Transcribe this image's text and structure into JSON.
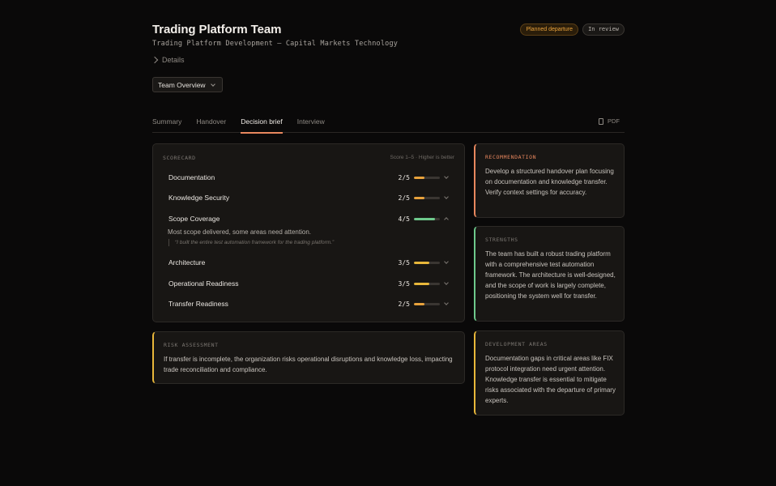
{
  "header": {
    "title": "Trading Platform Team",
    "subtitle": "Trading Platform Development — Capital Markets Technology",
    "details_label": "Details",
    "badges": {
      "planned": "Planned departure",
      "review": "In review"
    }
  },
  "team_select": {
    "selected": "Team Overview"
  },
  "tabs": [
    {
      "label": "Summary"
    },
    {
      "label": "Handover"
    },
    {
      "label": "Decision brief",
      "active": true
    },
    {
      "label": "Interview"
    }
  ],
  "pdf_label": "PDF",
  "scorecard": {
    "label": "SCORECARD",
    "hint": "Score 1–5 · Higher is better",
    "rows": [
      {
        "name": "Documentation",
        "score": "2/5",
        "value": 2,
        "color": "#e8a23c"
      },
      {
        "name": "Knowledge Security",
        "score": "2/5",
        "value": 2,
        "color": "#e8a23c"
      },
      {
        "name": "Scope Coverage",
        "score": "4/5",
        "value": 4,
        "color": "#6ec98c",
        "expanded": true
      },
      {
        "name": "Architecture",
        "score": "3/5",
        "value": 3,
        "color": "#e8b73a"
      },
      {
        "name": "Operational Readiness",
        "score": "3/5",
        "value": 3,
        "color": "#e8b73a"
      },
      {
        "name": "Transfer Readiness",
        "score": "2/5",
        "value": 2,
        "color": "#e8a23c"
      }
    ],
    "expanded_note": "Most scope delivered, some areas need attention.",
    "expanded_quote": "“I built the entire test automation framework for the trading platform.”"
  },
  "risk": {
    "label": "RISK ASSESSMENT",
    "body": "If transfer is incomplete, the organization risks operational disruptions and knowledge loss, impacting trade reconciliation and compliance."
  },
  "recommendation": {
    "label": "RECOMMENDATION",
    "body": "Develop a structured handover plan focusing on documentation and knowledge transfer. Verify context settings for accuracy."
  },
  "strengths": {
    "label": "STRENGTHS",
    "body": "The team has built a robust trading platform with a comprehensive test automation framework. The architecture is well-designed, and the scope of work is largely complete, positioning the system well for transfer."
  },
  "development": {
    "label": "DEVELOPMENT AREAS",
    "body": "Documentation gaps in critical areas like FIX protocol integration need urgent attention. Knowledge transfer is essential to mitigate risks associated with the departure of primary experts."
  },
  "colors": {
    "accent": "#e8875e",
    "green": "#6ec98c",
    "amber": "#e8b73a",
    "orange": "#e8a23c"
  }
}
